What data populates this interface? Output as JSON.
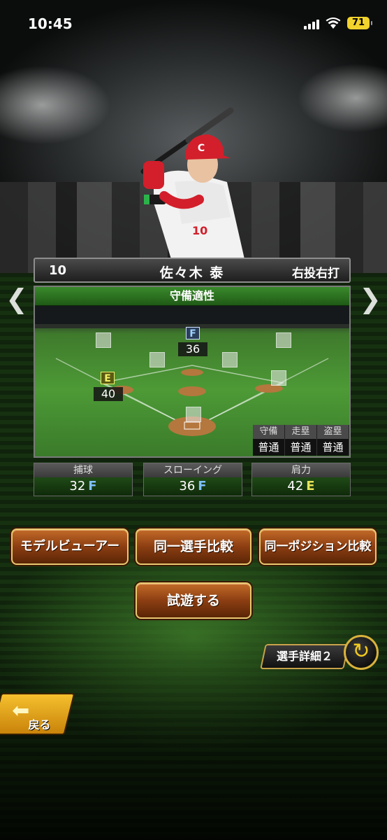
{
  "status_bar": {
    "time": "10:45",
    "battery": "71"
  },
  "player": {
    "number": "10",
    "name": "佐々木 泰",
    "handedness": "右投右打",
    "uniform_number": "10"
  },
  "defense_panel": {
    "title": "守備適性",
    "positions": [
      {
        "code": "F",
        "value": "36",
        "grade_color": "#9fd3ff"
      },
      {
        "code": "E",
        "value": "40",
        "grade_color": "#f4f06a"
      }
    ],
    "abilities": [
      {
        "label": "守備",
        "value": "普通"
      },
      {
        "label": "走塁",
        "value": "普通"
      },
      {
        "label": "盗塁",
        "value": "普通"
      }
    ]
  },
  "stats": [
    {
      "label": "捕球",
      "value": "32",
      "grade": "F"
    },
    {
      "label": "スローイング",
      "value": "36",
      "grade": "F"
    },
    {
      "label": "肩力",
      "value": "42",
      "grade": "E"
    }
  ],
  "buttons": {
    "model_viewer": "モデルビューアー",
    "same_player_compare": "同一選手比較",
    "same_position_compare": "同一ポジション比較",
    "try_play": "試遊する",
    "player_detail": "選手詳細２",
    "back": "戻る"
  },
  "icons": {
    "left_arrow": "chevron-left-icon",
    "right_arrow": "chevron-right-icon",
    "swap": "swap-icon",
    "back_arrow": "back-arrow-icon"
  },
  "colors": {
    "accent_gold": "#d9b23c",
    "button_brown": "#8c3e12",
    "panel_green": "#2f7a22"
  }
}
